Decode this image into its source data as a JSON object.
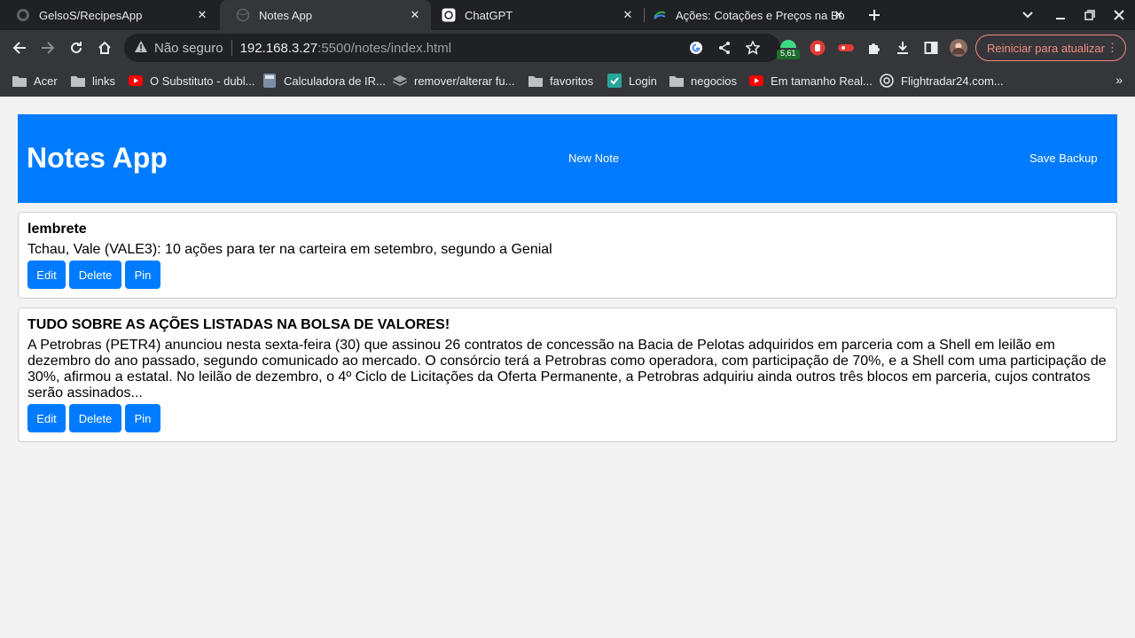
{
  "browser": {
    "tabs": [
      {
        "title": "GelsoS/RecipesApp",
        "icon": "github-icon"
      },
      {
        "title": "Notes App",
        "icon": "globe-icon",
        "active": true
      },
      {
        "title": "ChatGPT",
        "icon": "chatgpt-icon"
      },
      {
        "title": "Ações: Cotações e Preços na Bo",
        "icon": "stocks-icon"
      }
    ],
    "omnibox": {
      "security_label": "Não seguro",
      "host": "192.168.3.27",
      "rest": ":5500/notes/index.html"
    },
    "extension_badge": "5,61",
    "restart_label": "Reiniciar para atualizar",
    "bookmarks": [
      {
        "label": "Acer",
        "icon": "folder-icon"
      },
      {
        "label": "links",
        "icon": "folder-icon"
      },
      {
        "label": "O Substituto - dubl...",
        "icon": "youtube-icon"
      },
      {
        "label": "Calculadora de IR...",
        "icon": "calculator-icon"
      },
      {
        "label": "remover/alterar fu...",
        "icon": "layers-icon"
      },
      {
        "label": "favoritos",
        "icon": "folder-icon"
      },
      {
        "label": "Login",
        "icon": "login-icon"
      },
      {
        "label": "negocios",
        "icon": "folder-icon"
      },
      {
        "label": "Em tamanho Real...",
        "icon": "youtube-icon"
      },
      {
        "label": "Flightradar24.com...",
        "icon": "radar-icon"
      }
    ],
    "bookmarks_more": "»"
  },
  "app": {
    "title": "Notes App",
    "new_note_label": "New Note",
    "save_backup_label": "Save Backup",
    "accent_color": "#007bff",
    "notes": [
      {
        "title": "lembrete",
        "body": "Tchau, Vale (VALE3): 10 ações para ter na carteira em setembro, segundo a Genial",
        "edit": "Edit",
        "delete": "Delete",
        "pin": "Pin"
      },
      {
        "title": "TUDO SOBRE AS AÇÕES LISTADAS NA BOLSA DE VALORES!",
        "body": "A Petrobras (PETR4) anunciou nesta sexta-feira (30) que assinou 26 contratos de concessão na Bacia de Pelotas adquiridos em parceria com a Shell em leilão em dezembro do ano passado, segundo comunicado ao mercado. O consórcio terá a Petrobras como operadora, com participação de 70%, e a Shell com uma participação de 30%, afirmou a estatal. No leilão de dezembro, o 4º Ciclo de Licitações da Oferta Permanente, a Petrobras adquiriu ainda outros três blocos em parceria, cujos contratos serão assinados...",
        "edit": "Edit",
        "delete": "Delete",
        "pin": "Pin"
      }
    ]
  }
}
